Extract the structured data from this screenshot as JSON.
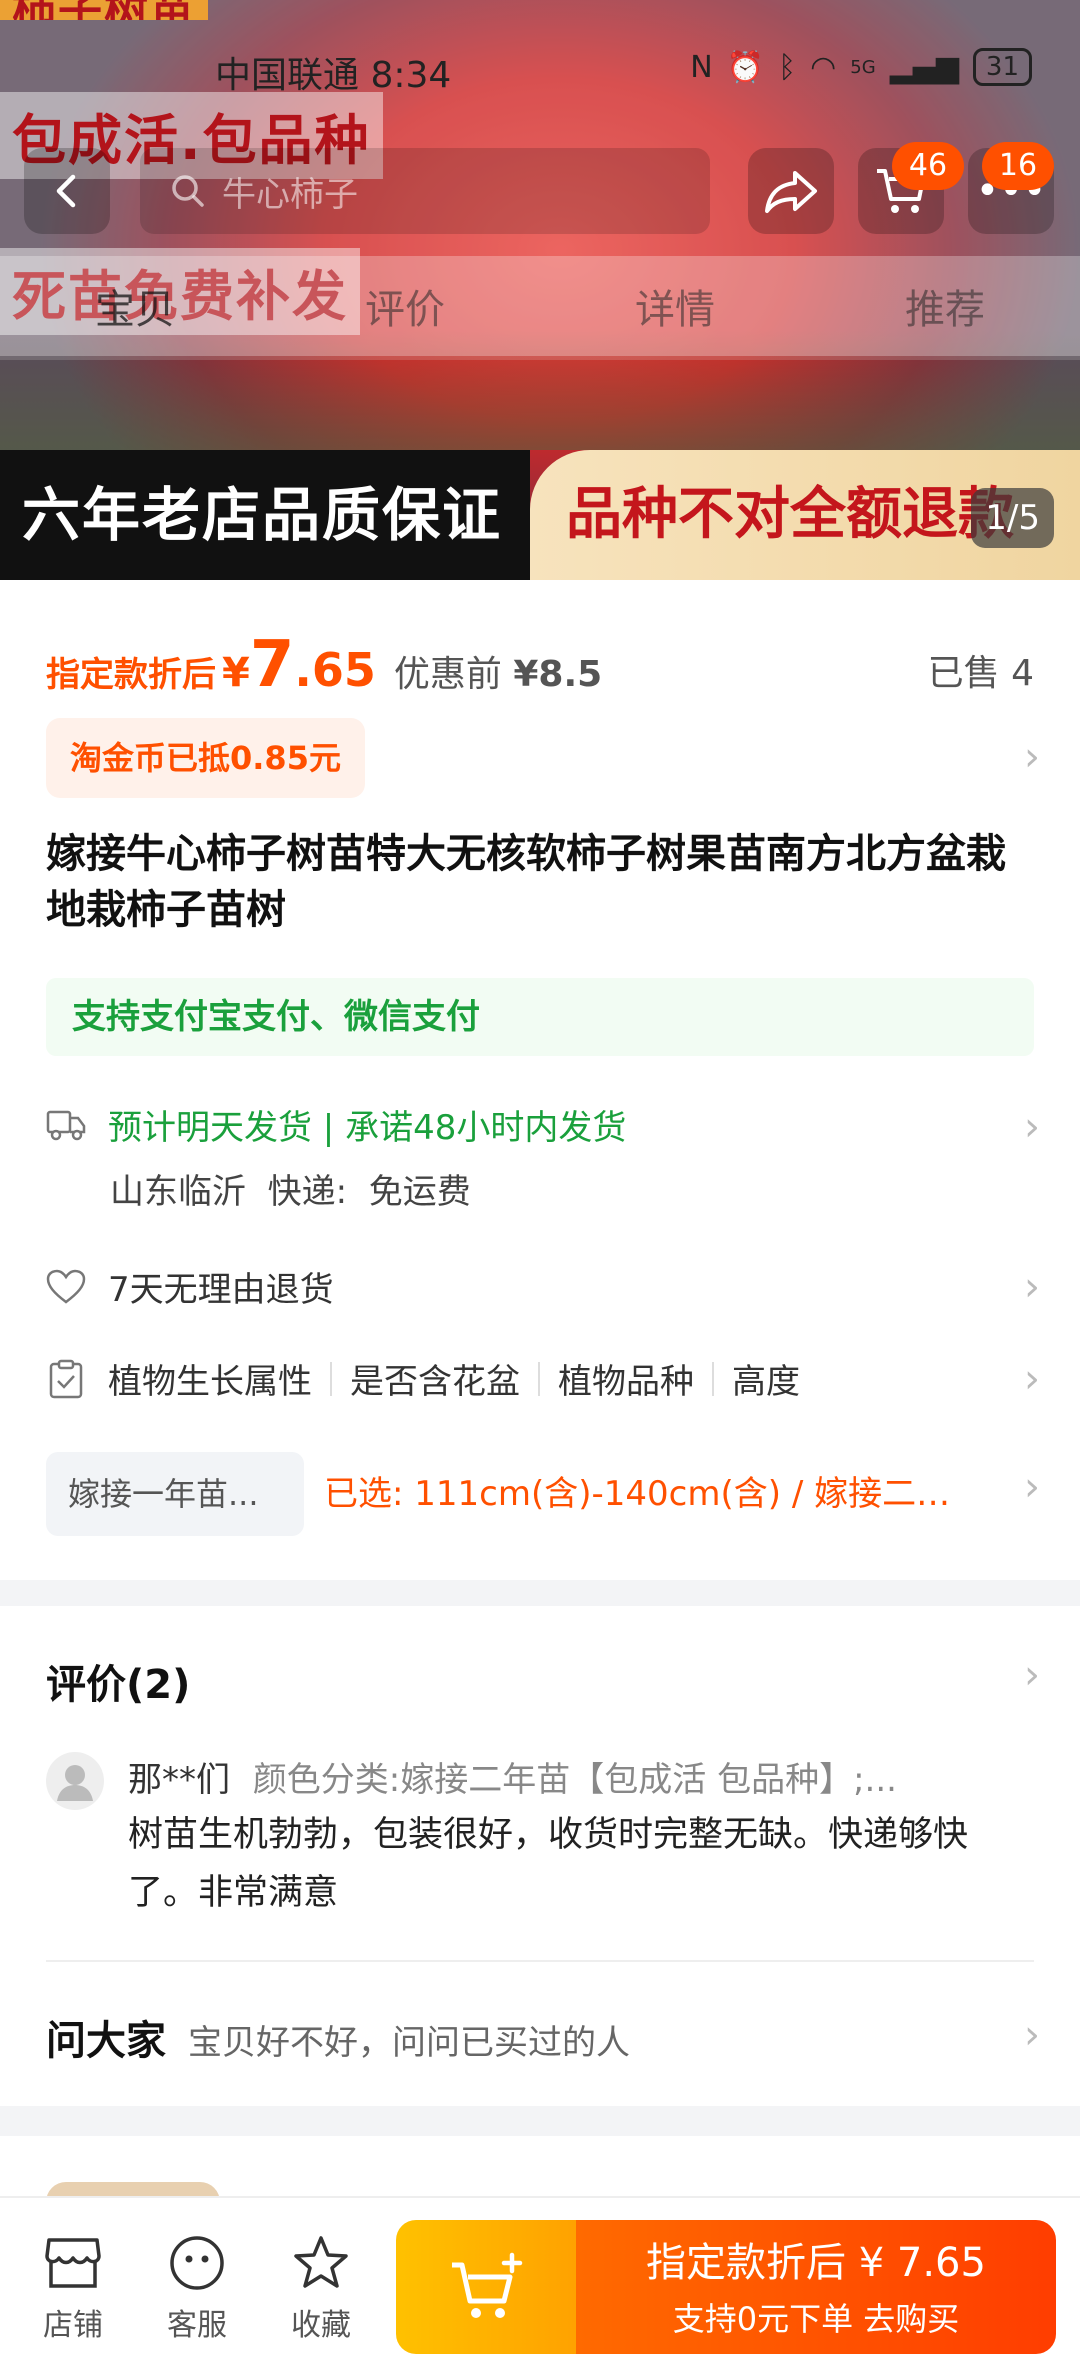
{
  "status": {
    "carrier": "中国联通",
    "time": "8:34",
    "network": "5G",
    "battery": "31"
  },
  "hero": {
    "promo_top": "柿子树苗",
    "promo_1": "包成活.包品种",
    "promo_2": "死苗免费补发",
    "banner_left": "六年老店品质保证",
    "banner_right": "品种不对全额退款",
    "counter": "1/5"
  },
  "nav": {
    "search_placeholder": "牛心柿子",
    "cart_badge": "46",
    "msg_badge": "16"
  },
  "tabs": [
    {
      "label": "宝贝"
    },
    {
      "label": "评价"
    },
    {
      "label": "详情"
    },
    {
      "label": "推荐"
    }
  ],
  "price": {
    "label": "指定款折后",
    "currency": "¥",
    "int": "7",
    "dec": ".65",
    "orig_label": "优惠前",
    "orig_value": "¥8.5",
    "sold": "已售 4"
  },
  "coin": "淘金币已抵0.85元",
  "title": "嫁接牛心柿子树苗特大无核软柿子树果苗南方北方盆栽地栽柿子苗树",
  "payment": "支持支付宝支付、微信支付",
  "shipping": {
    "line": "预计明天发货 | 承诺48小时内发货",
    "origin": "山东临沂",
    "express_label": "快递:",
    "express_value": "免运费"
  },
  "returns": "7天无理由退货",
  "attributes": [
    "植物生长属性",
    "是否含花盆",
    "植物品种",
    "高度"
  ],
  "spec": {
    "box": "嫁接一年苗...",
    "selected": "已选: 111cm(含)-140cm(含) / 嫁接二年苗..."
  },
  "reviews": {
    "title": "评价(2)",
    "user": "那**们",
    "variant": "颜色分类:嫁接二年苗【包成活 包品种】;...",
    "body": "树苗生机勃勃，包装很好，收货时完整无缺。快递够快了。非常满意"
  },
  "ask": {
    "title": "问大家",
    "text": "宝贝好不好，问问已买过的人"
  },
  "bottom": {
    "store": "店铺",
    "service": "客服",
    "favorite": "收藏",
    "buy_line1": "指定款折后 ¥ 7.65",
    "buy_line2": "支持0元下单  去购买"
  },
  "colors": {
    "accent": "#ff5000",
    "green": "#1aa03c"
  }
}
